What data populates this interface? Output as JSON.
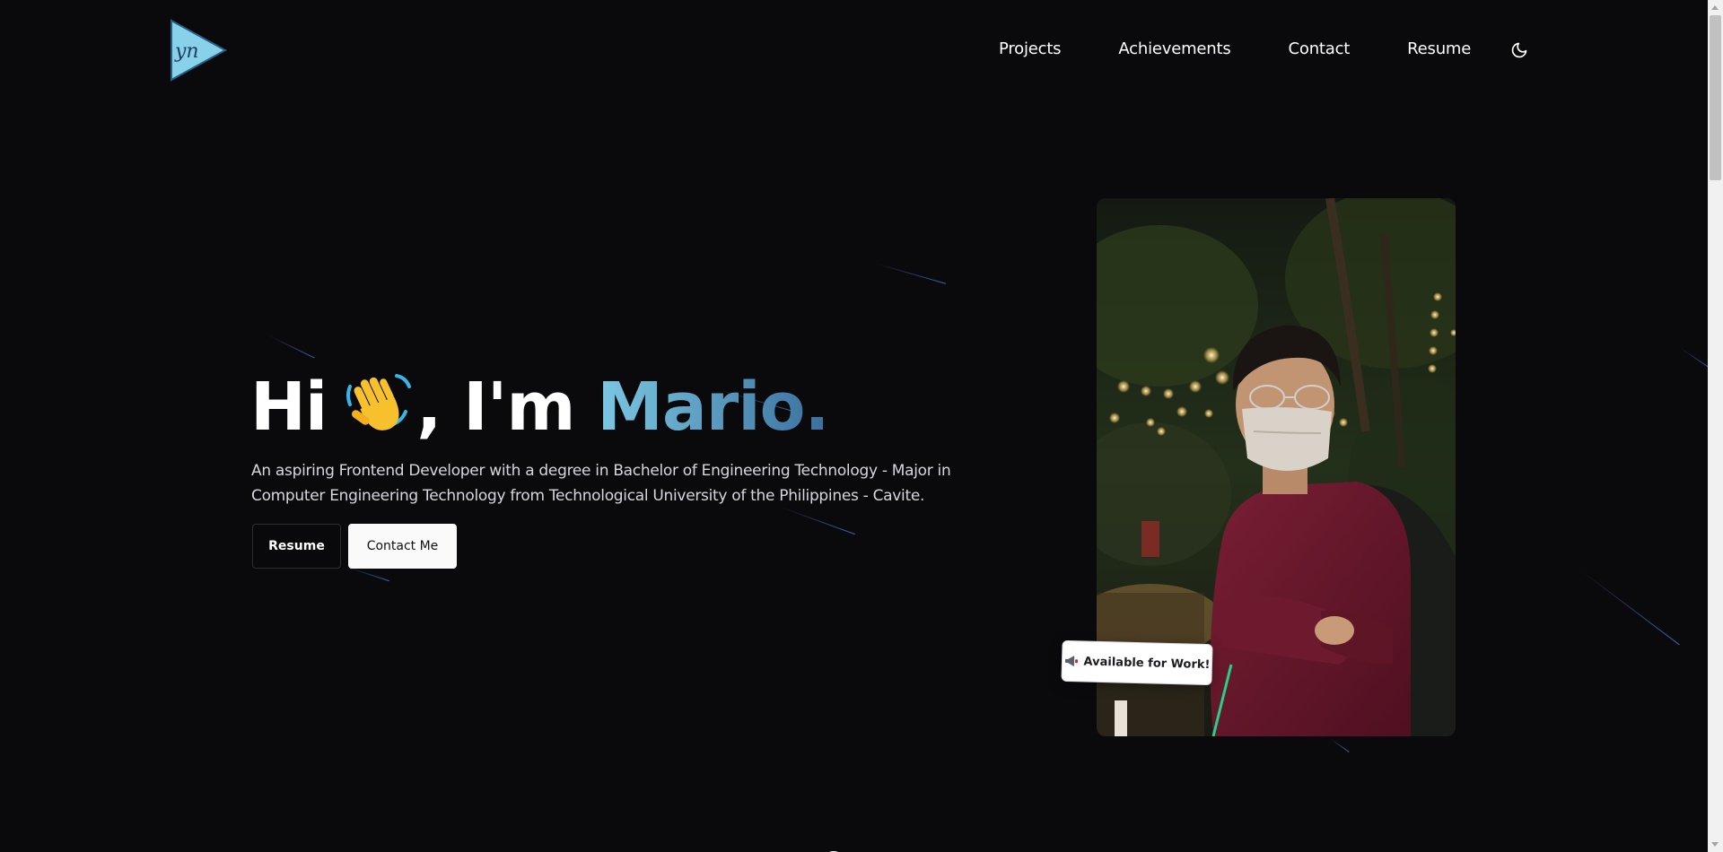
{
  "header": {
    "logo_icon": "yn-triangle-logo",
    "nav": [
      {
        "label": "Projects"
      },
      {
        "label": "Achievements"
      },
      {
        "label": "Contact"
      },
      {
        "label": "Resume"
      }
    ],
    "theme_icon": "moon-icon"
  },
  "hero": {
    "greeting": "Hi",
    "wave_icon": "waving-hand-icon",
    "intro": ", I'm",
    "name": "Mario.",
    "description": "An aspiring Frontend Developer with a degree in Bachelor of Engineering Technology - Major in Computer Engineering Technology from Technological University of the Philippines - Cavite.",
    "buttons": {
      "resume_label": "Resume",
      "contact_label": "Contact Me"
    }
  },
  "photo": {
    "badge_icon": "megaphone-icon",
    "badge_label": "Available for Work!"
  },
  "colors": {
    "background": "#0a0a0d",
    "accent_start": "#7cc8e3",
    "accent_end": "#3a6f9d",
    "logo_fill": "#87d1ea"
  }
}
